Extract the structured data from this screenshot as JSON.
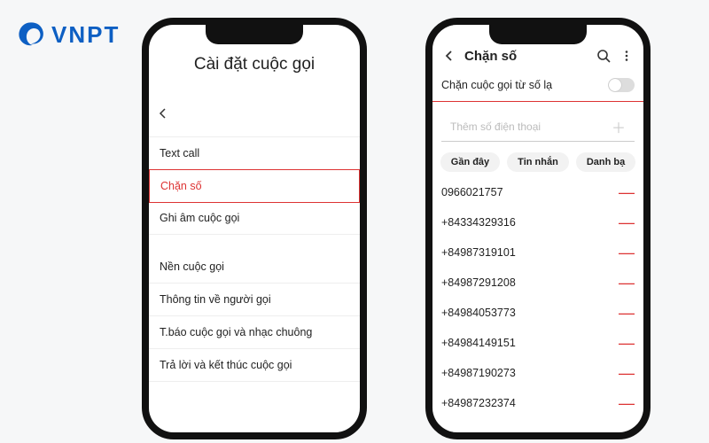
{
  "logo": {
    "text": "VNPT"
  },
  "phone_left": {
    "title": "Cài đặt cuộc gọi",
    "items": [
      "Text call",
      "Chặn số",
      "Ghi âm cuộc gọi",
      "Nền cuộc gọi",
      "Thông tin về người gọi",
      "T.báo cuộc gọi và nhạc chuông",
      "Trả lời và kết thúc cuộc gọi"
    ],
    "selected_index": 1
  },
  "phone_right": {
    "header": "Chặn số",
    "toggle_label": "Chặn cuộc gọi từ số lạ",
    "toggle_on": false,
    "add_placeholder": "Thêm số điện thoại",
    "chips": [
      "Gần đây",
      "Tin nhắn",
      "Danh bạ"
    ],
    "numbers": [
      "0966021757",
      "+84334329316",
      "+84987319101",
      "+84987291208",
      "+84984053773",
      "+84984149151",
      "+84987190273",
      "+84987232374"
    ]
  }
}
